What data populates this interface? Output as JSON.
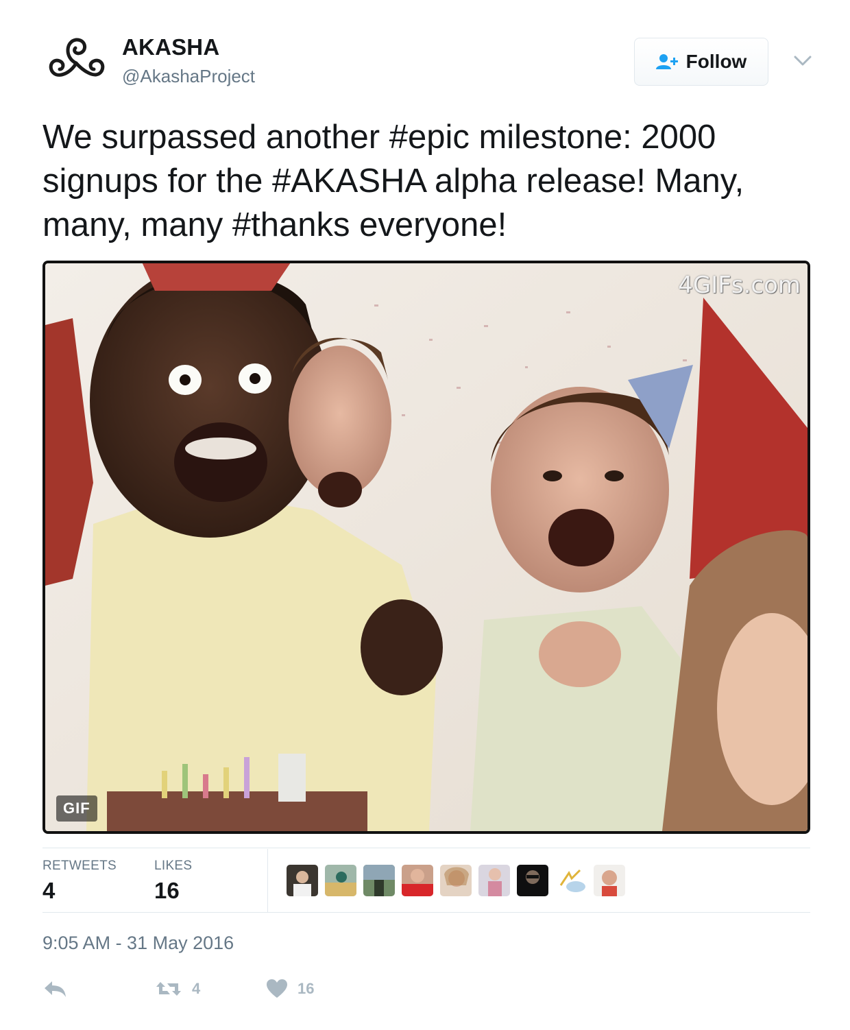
{
  "account": {
    "name": "AKASHA",
    "handle": "@AkashaProject"
  },
  "follow_button": {
    "label": "Follow"
  },
  "tweet": {
    "text": "We surpassed another #epic milestone: 2000 signups for the #AKASHA alpha release! Many, many, many #thanks everyone!"
  },
  "media": {
    "watermark": "4GIFs.com",
    "badge": "GIF"
  },
  "stats": {
    "retweets_label": "RETWEETS",
    "retweets_count": "4",
    "likes_label": "LIKES",
    "likes_count": "16"
  },
  "timestamp": "9:05 AM - 31 May 2016",
  "actions": {
    "reply_icon": "reply-icon",
    "retweet_icon": "retweet-icon",
    "retweet_count": "4",
    "like_icon": "heart-icon",
    "like_count": "16"
  },
  "likers_count": 9,
  "colors": {
    "text": "#14171a",
    "secondary": "#657786",
    "follow_icon": "#1da1f2",
    "action_icon": "#aab8c2"
  }
}
